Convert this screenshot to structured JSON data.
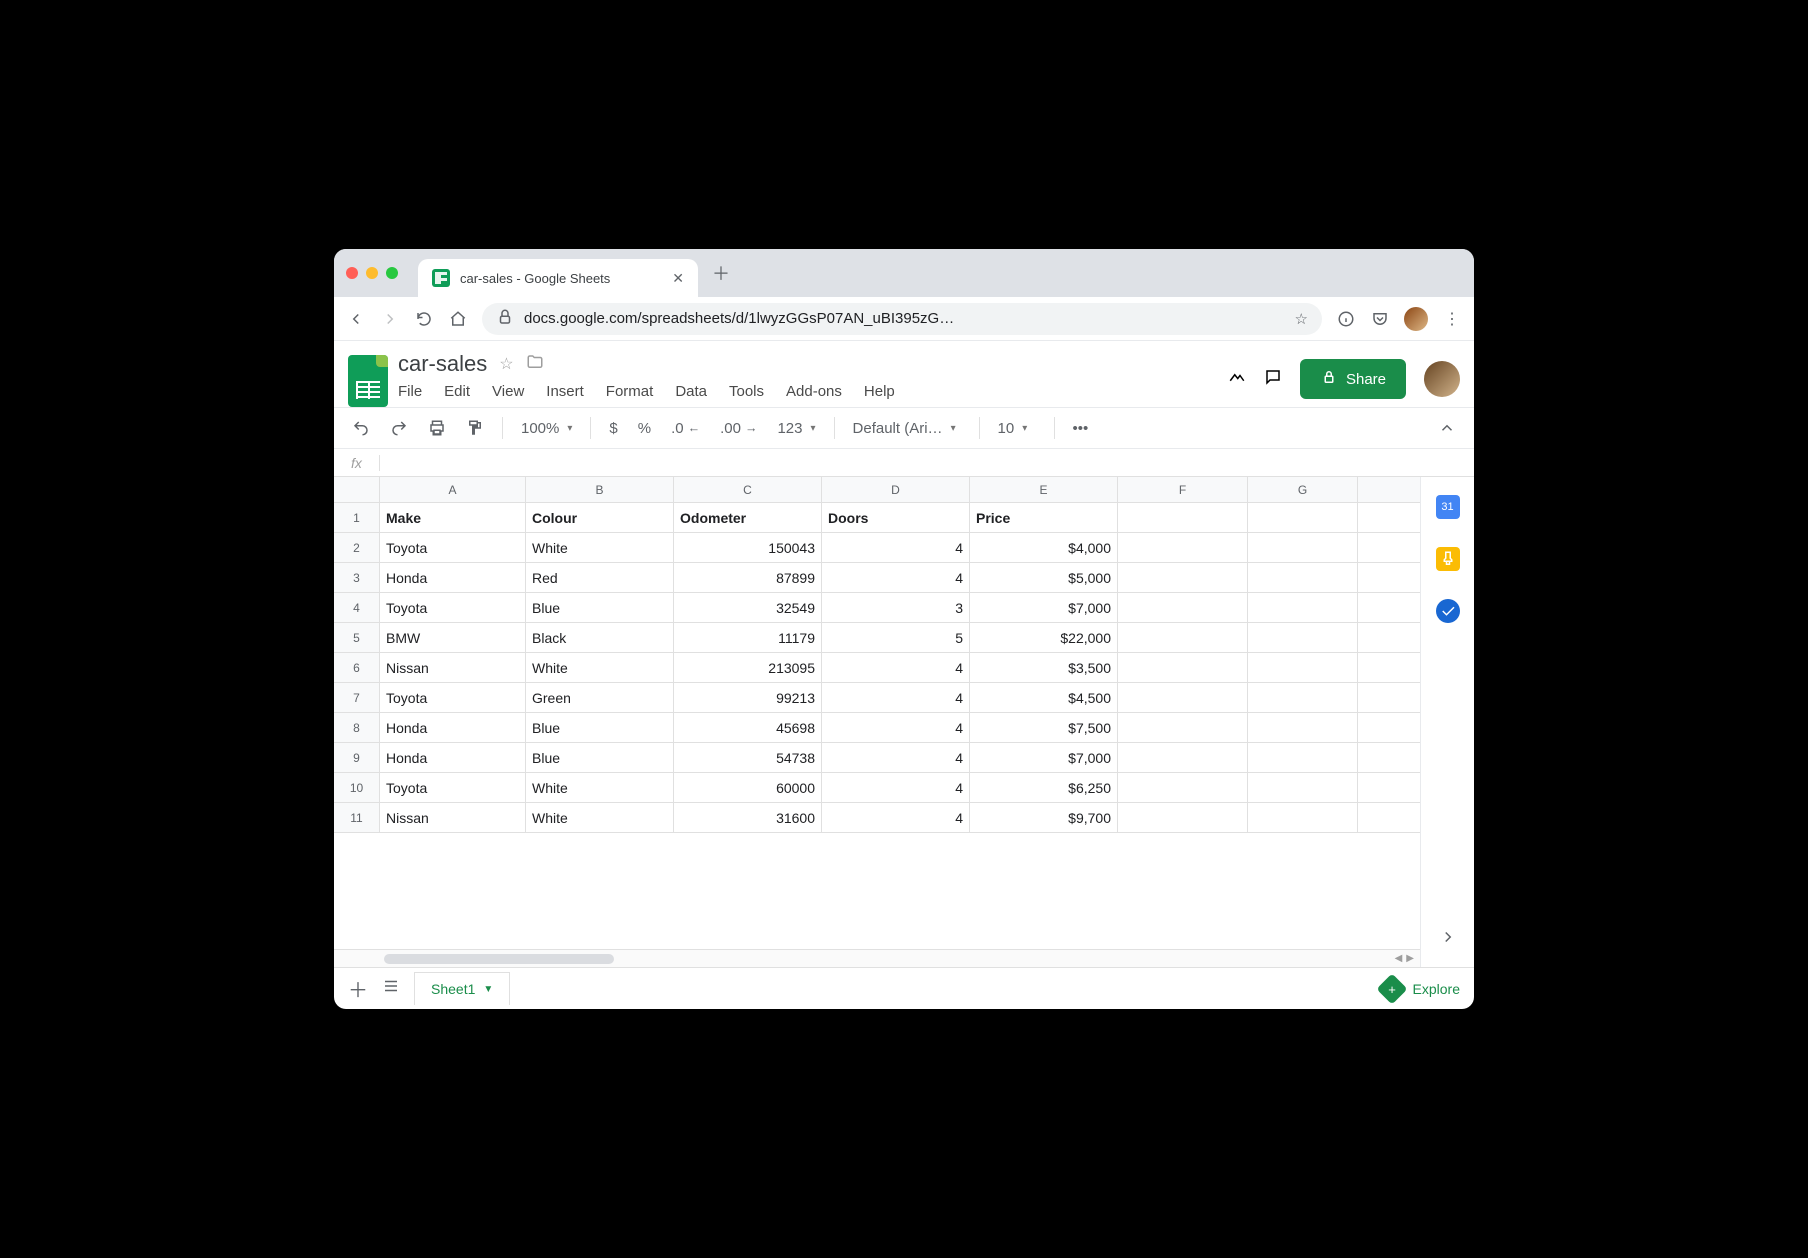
{
  "browser": {
    "tab_title": "car-sales - Google Sheets",
    "url_display": "docs.google.com/spreadsheets/d/1lwyzGGsP07AN_uBI395zG…"
  },
  "doc": {
    "title": "car-sales",
    "menus": [
      "File",
      "Edit",
      "View",
      "Insert",
      "Format",
      "Data",
      "Tools",
      "Add-ons",
      "Help"
    ],
    "share_label": "Share"
  },
  "toolbar": {
    "zoom": "100%",
    "currency": "$",
    "percent": "%",
    "dec_less": ".0",
    "dec_more": ".00",
    "format_num": "123",
    "font": "Default (Ari…",
    "font_size": "10"
  },
  "fx": "fx",
  "columns": [
    "A",
    "B",
    "C",
    "D",
    "E",
    "F",
    "G"
  ],
  "header_row": [
    "Make",
    "Colour",
    "Odometer",
    "Doors",
    "Price"
  ],
  "rows": [
    {
      "n": "1"
    },
    {
      "n": "2",
      "make": "Toyota",
      "colour": "White",
      "odo": "150043",
      "doors": "4",
      "price": "$4,000"
    },
    {
      "n": "3",
      "make": "Honda",
      "colour": "Red",
      "odo": "87899",
      "doors": "4",
      "price": "$5,000"
    },
    {
      "n": "4",
      "make": "Toyota",
      "colour": "Blue",
      "odo": "32549",
      "doors": "3",
      "price": "$7,000"
    },
    {
      "n": "5",
      "make": "BMW",
      "colour": "Black",
      "odo": "11179",
      "doors": "5",
      "price": "$22,000"
    },
    {
      "n": "6",
      "make": "Nissan",
      "colour": "White",
      "odo": "213095",
      "doors": "4",
      "price": "$3,500"
    },
    {
      "n": "7",
      "make": "Toyota",
      "colour": "Green",
      "odo": "99213",
      "doors": "4",
      "price": "$4,500"
    },
    {
      "n": "8",
      "make": "Honda",
      "colour": "Blue",
      "odo": "45698",
      "doors": "4",
      "price": "$7,500"
    },
    {
      "n": "9",
      "make": "Honda",
      "colour": "Blue",
      "odo": "54738",
      "doors": "4",
      "price": "$7,000"
    },
    {
      "n": "10",
      "make": "Toyota",
      "colour": "White",
      "odo": "60000",
      "doors": "4",
      "price": "$6,250"
    },
    {
      "n": "11",
      "make": "Nissan",
      "colour": "White",
      "odo": "31600",
      "doors": "4",
      "price": "$9,700"
    }
  ],
  "sheet_tab": "Sheet1",
  "explore": "Explore",
  "sidebar_calendar_day": "31"
}
